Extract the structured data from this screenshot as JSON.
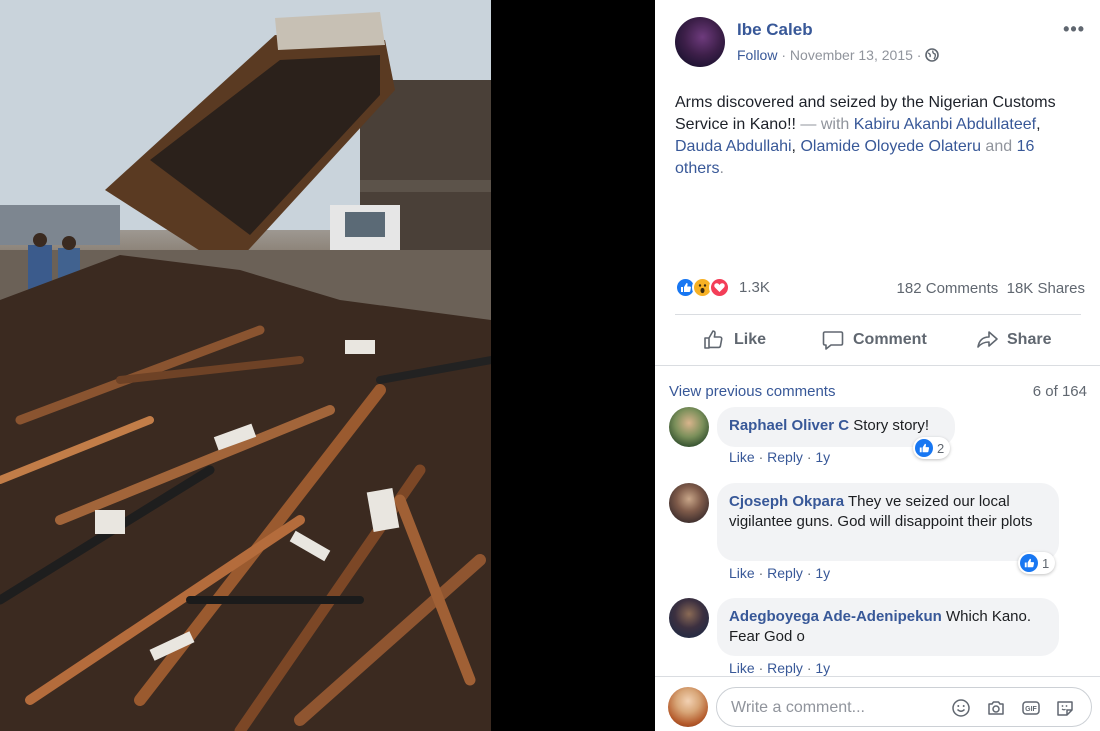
{
  "post": {
    "author": "Ibe Caleb",
    "follow": "Follow",
    "date": "November 13, 2015",
    "text_main": "Arms discovered and seized by the Nigerian Customs Service in Kano!!",
    "text_with": " — with ",
    "tagged": [
      "Kabiru Akanbi Abdullateef",
      "Dauda Abdullahi",
      "Olamide Oloyede Olateru"
    ],
    "sep": ", ",
    "and": " and ",
    "others": "16 others",
    "period": "."
  },
  "stats": {
    "reactions_count": "1.3K",
    "comments": "182 Comments",
    "shares": "18K Shares"
  },
  "actions": {
    "like": "Like",
    "comment": "Comment",
    "share": "Share"
  },
  "comments_section": {
    "view_previous": "View previous comments",
    "count": "6 of 164",
    "items": [
      {
        "name": "Raphael Oliver C",
        "text": "Story story!",
        "like": "Like",
        "reply": "Reply",
        "age": "1y",
        "reactions": "2"
      },
      {
        "name": "Cjoseph Okpara",
        "text": "They ve seized our local vigilantee guns. God will disappoint their plots",
        "like": "Like",
        "reply": "Reply",
        "age": "1y",
        "reactions": "1"
      },
      {
        "name": "Adegboyega Ade-Adenipekun",
        "text": "Which Kano. Fear God o",
        "like": "Like",
        "reply": "Reply",
        "age": "1y"
      }
    ]
  },
  "composer": {
    "placeholder": "Write a comment..."
  },
  "icons": {
    "more": "ellipsis-icon",
    "audience": "globe-icon",
    "like": "thumbs-up-icon",
    "comment": "speech-bubble-icon",
    "share": "share-arrow-icon",
    "emoji": "smiley-icon",
    "camera": "camera-icon",
    "gif": "gif-icon",
    "sticker": "sticker-icon"
  },
  "colors": {
    "link": "#385898",
    "muted": "#606770",
    "like_blue": "#1877f2",
    "love_red": "#f33e58",
    "wow_yellow": "#f7b125"
  }
}
